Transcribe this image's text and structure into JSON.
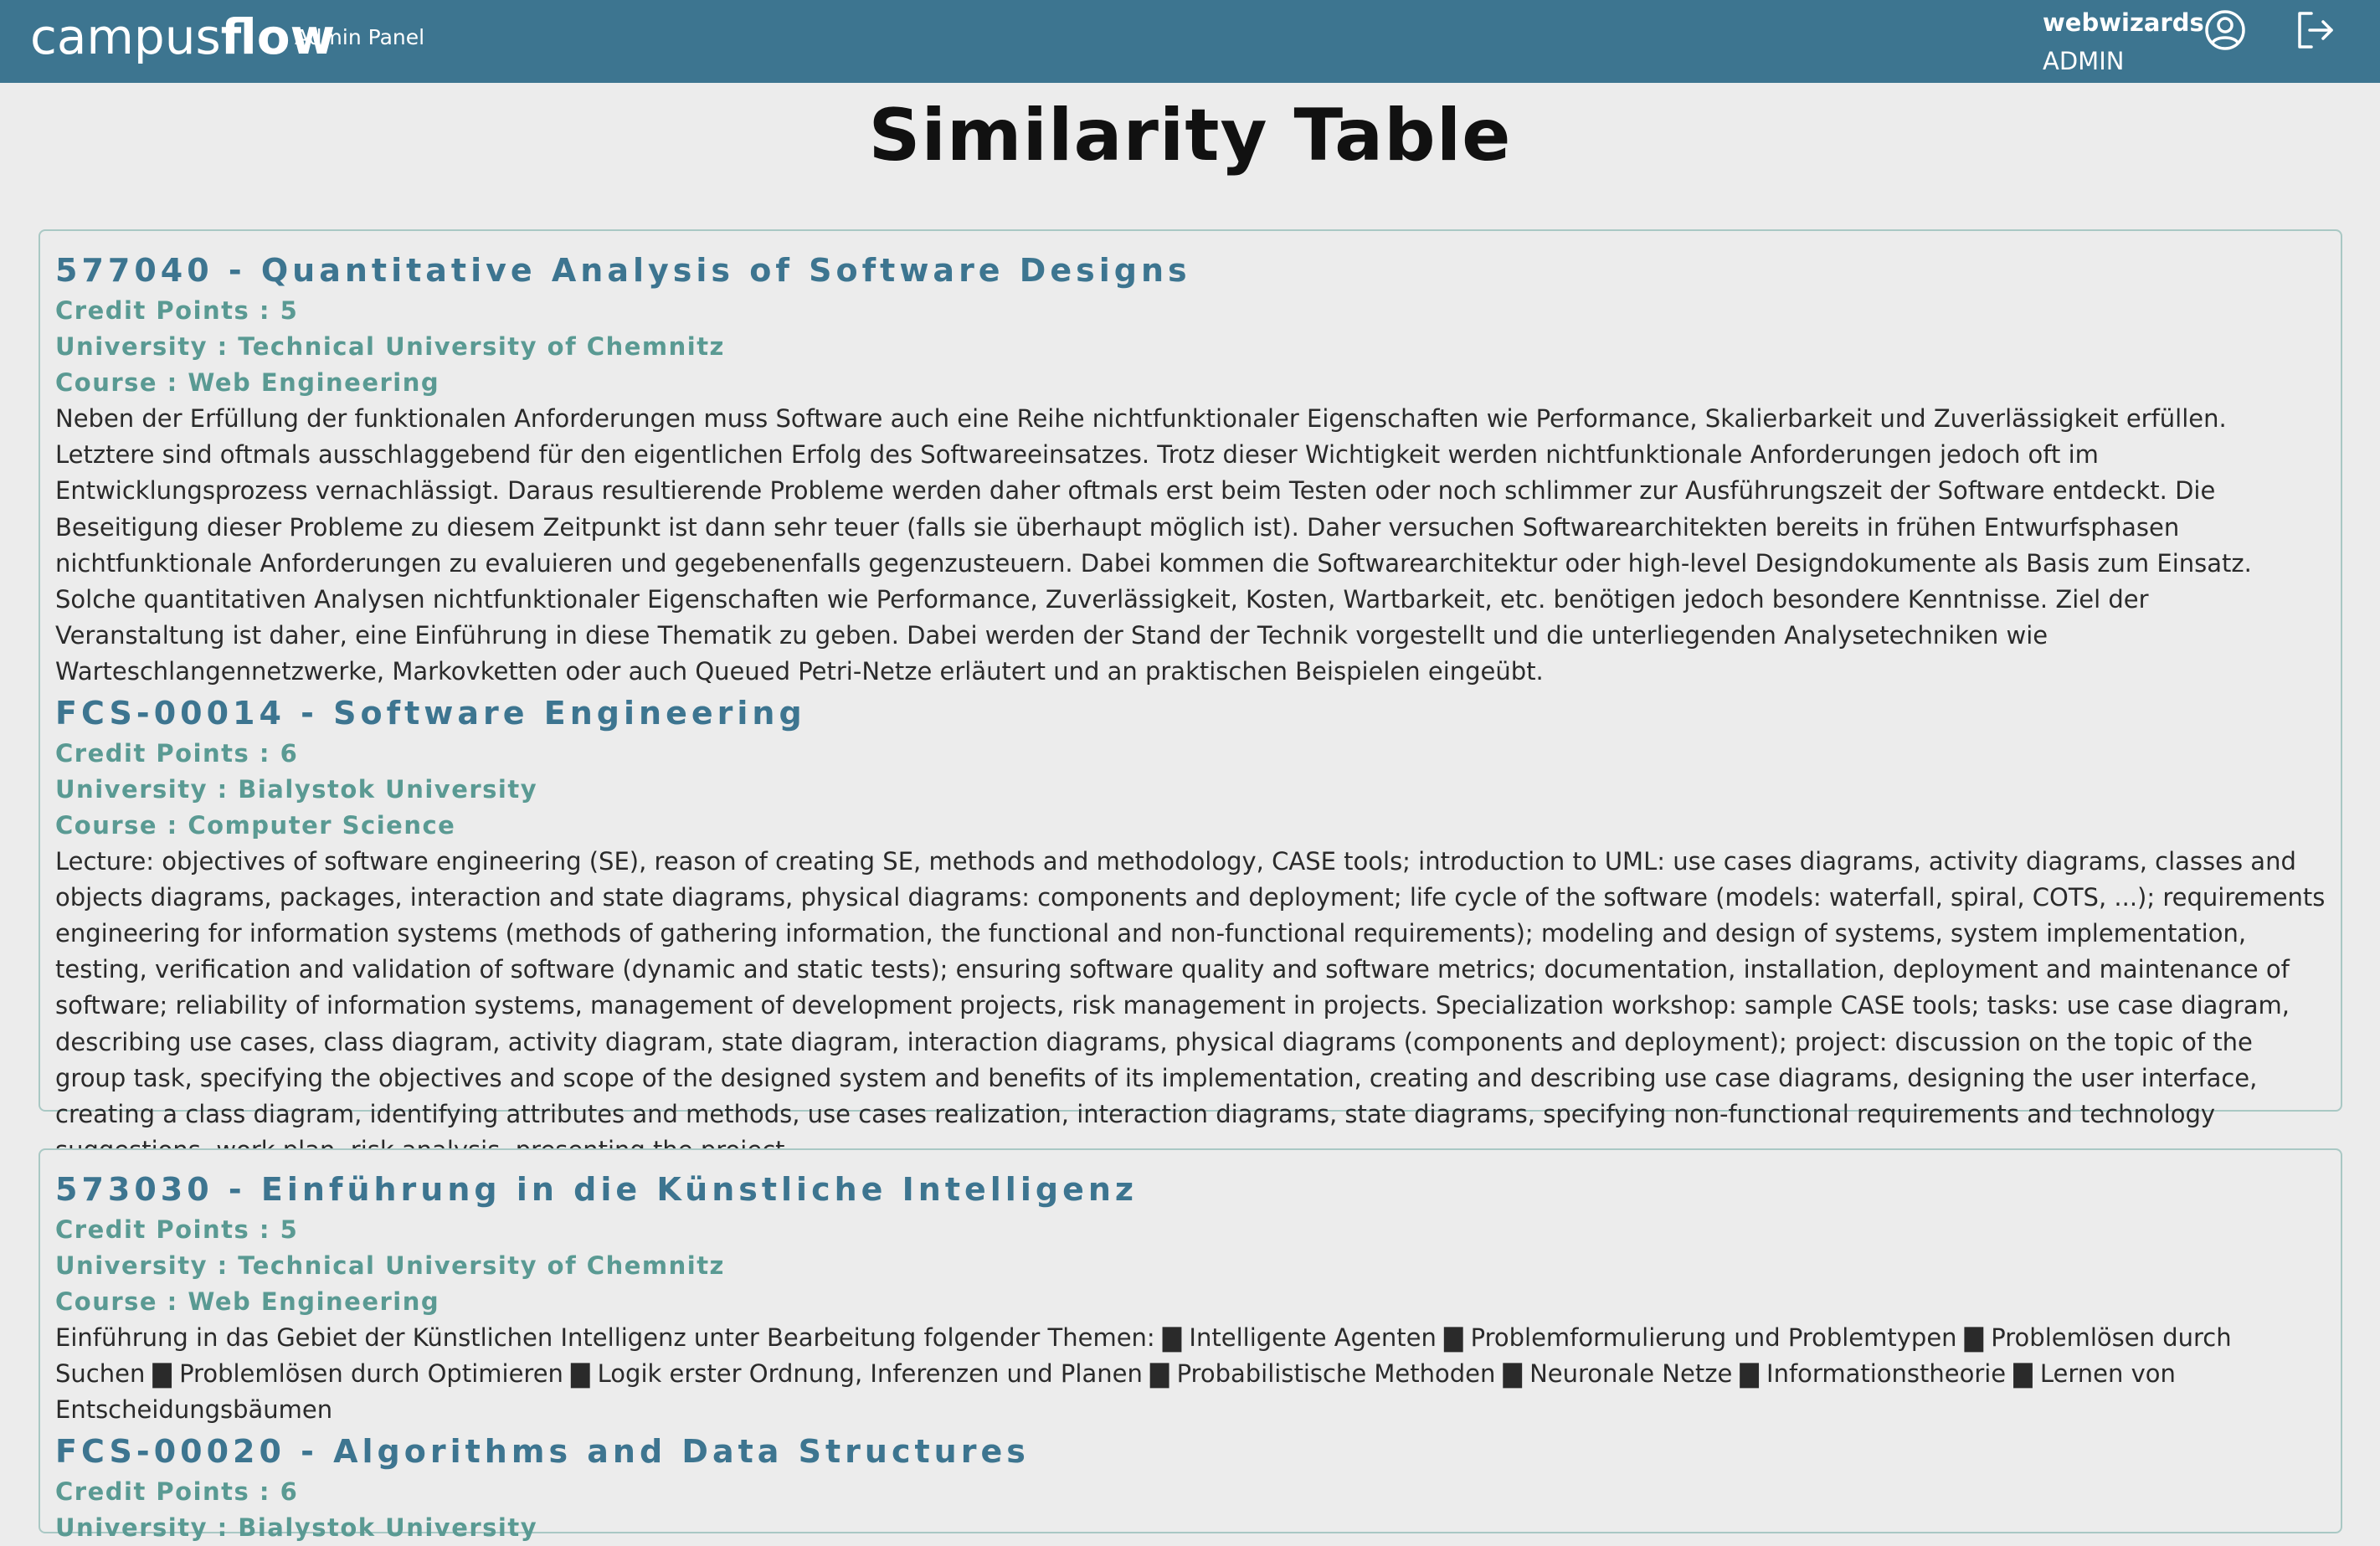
{
  "header": {
    "brand_light": "campus",
    "brand_bold": "flow",
    "panel_label": "Admin Panel",
    "username": "webwizards",
    "role": "ADMIN",
    "user_icon": "user-circle-icon",
    "logout_icon": "logout-icon",
    "bar_color": "#3d7590"
  },
  "page": {
    "title": "Similarity Table"
  },
  "cards": [
    {
      "courses": [
        {
          "title": "577040 - Quantitative Analysis of Software Designs",
          "credit_points": "Credit Points : 5",
          "university": "University : Technical University of Chemnitz",
          "course": "Course : Web Engineering",
          "description": "Neben der Erfüllung der funktionalen Anforderungen muss Software auch eine Reihe nichtfunktionaler Eigenschaften wie Performance, Skalierbarkeit und Zuverlässigkeit erfüllen. Letztere sind oftmals ausschlaggebend für den eigentlichen Erfolg des Softwareeinsatzes. Trotz dieser Wichtigkeit werden nichtfunktionale Anforderungen jedoch oft im Entwicklungsprozess vernachlässigt. Daraus resultierende Probleme werden daher oftmals erst beim Testen oder noch schlimmer zur Ausführungszeit der Software entdeckt. Die Beseitigung dieser Probleme zu diesem Zeitpunkt ist dann sehr teuer (falls sie überhaupt möglich ist). Daher versuchen Softwarearchitekten bereits in frühen Entwurfsphasen nichtfunktionale Anforderungen zu evaluieren und gegebenenfalls gegenzusteuern. Dabei kommen die Softwarearchitektur oder high-level Designdokumente als Basis zum Einsatz. Solche quantitativen Analysen nichtfunktionaler Eigenschaften wie Performance, Zuverlässigkeit, Kosten, Wartbarkeit, etc. benötigen jedoch besondere Kenntnisse. Ziel der Veranstaltung ist daher, eine Einführung in diese Thematik zu geben. Dabei werden der Stand der Technik vorgestellt und die unterliegenden Analysetechniken wie Warteschlangennetzwerke, Markovketten oder auch Queued Petri-Netze erläutert und an praktischen Beispielen eingeübt."
        },
        {
          "title": "FCS-00014 - Software Engineering",
          "credit_points": "Credit Points : 6",
          "university": "University : Bialystok University",
          "course": "Course : Computer Science",
          "description": "Lecture: objectives of software engineering (SE), reason of creating SE, methods and methodology, CASE tools; introduction to UML: use cases diagrams, activity diagrams, classes and objects diagrams, packages, interaction and state diagrams, physical diagrams: components and deployment; life cycle of the software (models: waterfall, spiral, COTS, ...); requirements engineering for information systems (methods of gathering information, the functional and non-functional requirements); modeling and design of systems, system implementation, testing, verification and validation of software (dynamic and static tests); ensuring software quality and software metrics; documentation, installation, deployment and maintenance of software; reliability of information systems, management of development projects, risk management in projects. Specialization workshop: sample CASE tools; tasks: use case diagram, describing use cases, class diagram, activity diagram, state diagram, interaction diagrams, physical diagrams (components and deployment); project: discussion on the topic of the group task, specifying the objectives and scope of the designed system and benefits of its implementation, creating and describing use case diagrams, designing the user interface, creating a class diagram, identifying attributes and methods, use cases realization, interaction diagrams, state diagrams, specifying non-functional requirements and technology suggestions, work plan, risk analysis, presenting the project."
        }
      ]
    },
    {
      "courses": [
        {
          "title": "573030 - Einführung in die Künstliche Intelligenz",
          "credit_points": "Credit Points : 5",
          "university": "University : Technical University of Chemnitz",
          "course": "Course : Web Engineering",
          "description": "Einführung in das Gebiet der Künstlichen Intelligenz unter Bearbeitung folgender Themen: ▇ Intelligente Agenten ▇ Problemformulierung und Problemtypen ▇ Problemlösen durch Suchen ▇ Problemlösen durch Optimieren ▇ Logik erster Ordnung, Inferenzen und Planen ▇ Probabilistische Methoden ▇ Neuronale Netze ▇ Informationstheorie ▇ Lernen von Entscheidungsbäumen"
        },
        {
          "title": "FCS-00020 - Algorithms and Data Structures",
          "credit_points": "Credit Points : 6",
          "university": "University : Bialystok University",
          "course": "",
          "description": ""
        }
      ]
    }
  ]
}
